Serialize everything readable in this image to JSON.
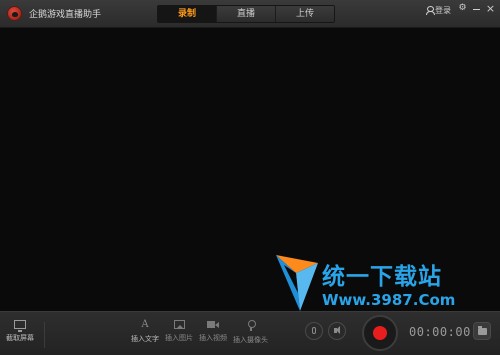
{
  "app": {
    "title": "企鹅游戏直播助手",
    "logo_icon": "penguin-logo-icon"
  },
  "tabs": [
    {
      "label": "录制",
      "active": true
    },
    {
      "label": "直播",
      "active": false
    },
    {
      "label": "上传",
      "active": false
    }
  ],
  "header": {
    "login_label": "登录",
    "icons": [
      "user-icon",
      "gear-icon",
      "minimize-icon",
      "close-icon"
    ]
  },
  "watermark": {
    "title": "统一下载站",
    "url": "Www.3987.Com"
  },
  "toolbar": {
    "capture_screen": "截取屏幕",
    "insert_text": "插入文字",
    "insert_image": "插入图片",
    "insert_video": "插入视频",
    "insert_camera": "插入摄像头",
    "timer": "00:00:00"
  },
  "colors": {
    "accent": "#ff9a1c",
    "record": "#e81e1e",
    "watermark": "#2aa4e8"
  }
}
